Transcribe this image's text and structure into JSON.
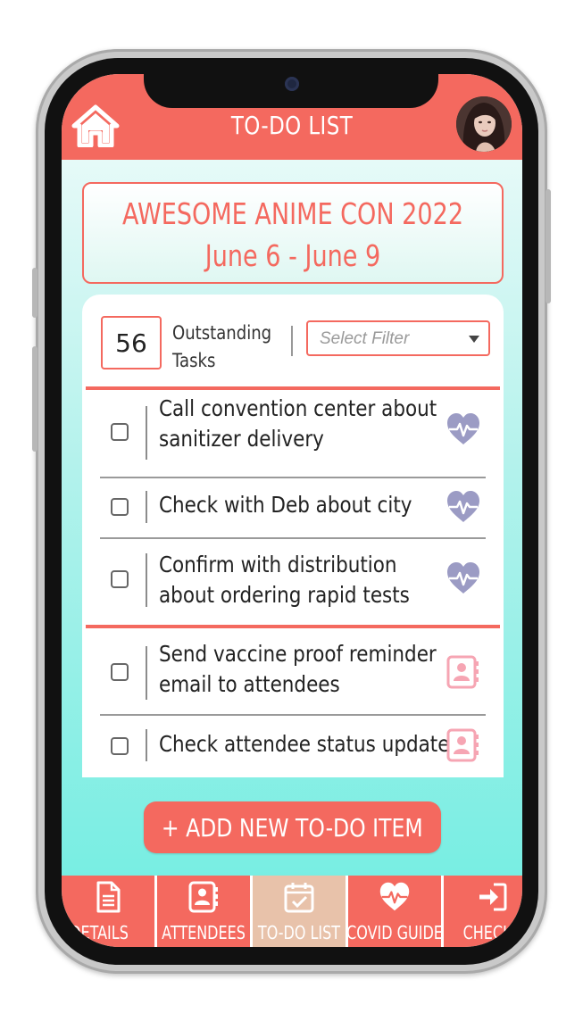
{
  "header": {
    "title": "TO-DO LIST",
    "home_icon": "home-icon",
    "avatar": "user-avatar-photo"
  },
  "event": {
    "title": "AWESOME ANIME CON 2022",
    "dates": "June 6 - June 9"
  },
  "summary": {
    "count": "56",
    "count_label": "Outstanding Tasks",
    "filter_placeholder": "Select Filter"
  },
  "tasks": [
    {
      "text_line1": "Call convention center about",
      "text_line2": "sanitizer delivery",
      "checked": false,
      "icon": "heart-pulse-icon"
    },
    {
      "text_line1": "Check with Deb about city",
      "text_line2": "",
      "checked": false,
      "icon": "heart-pulse-icon"
    },
    {
      "text_line1": "Confirm with distribution",
      "text_line2": "about ordering rapid tests",
      "checked": false,
      "icon": "heart-pulse-icon"
    },
    {
      "text_line1": "Send vaccine proof reminder",
      "text_line2": "email to attendees",
      "checked": false,
      "icon": "contact-book-icon"
    },
    {
      "text_line1": "Check attendee status update",
      "text_line2": "",
      "checked": false,
      "icon": "contact-book-icon"
    }
  ],
  "actions": {
    "add_label": "+ ADD NEW TO-DO ITEM"
  },
  "nav": {
    "items": [
      {
        "label": "DETAILS",
        "icon": "document-icon",
        "active": false
      },
      {
        "label": "ATTENDEES",
        "icon": "contact-book-icon",
        "active": false
      },
      {
        "label": "TO-DO LIST",
        "icon": "calendar-check-icon",
        "active": true
      },
      {
        "label": "COVID GUIDE",
        "icon": "heart-pulse-icon",
        "active": false
      },
      {
        "label": "CHECK-I",
        "icon": "sign-in-icon",
        "active": false
      }
    ]
  },
  "colors": {
    "accent": "#f4695f",
    "heart_icon": "#9b9bc4",
    "contact_icon": "#f6a5b3",
    "active_tab": "#e8c2aa",
    "background_top": "#f4fcfb",
    "background_bottom": "#6eede1"
  }
}
